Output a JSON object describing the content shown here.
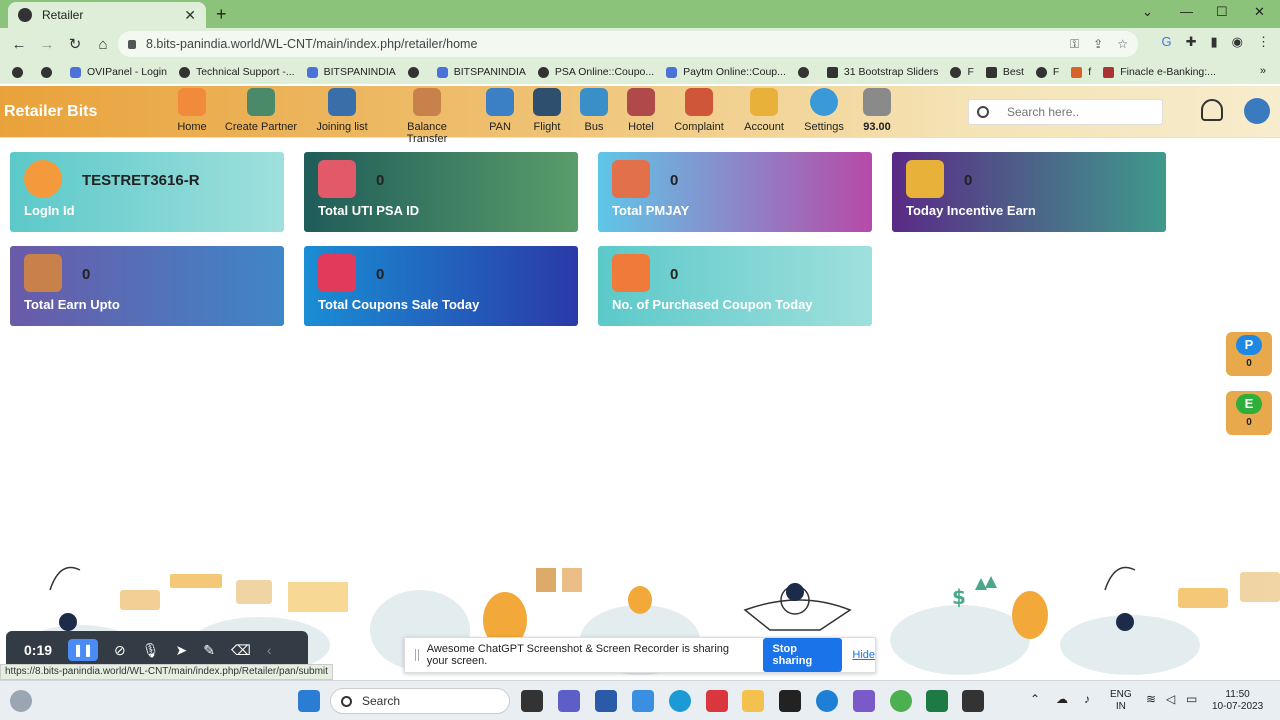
{
  "browser": {
    "tab_title": "Retailer",
    "url": "8.bits-panindia.world/WL-CNT/main/index.php/retailer/home",
    "bookmarks": [
      "OVIPanel - Login",
      "Technical Support -...",
      "BITSPANINDIA",
      "BITSPANINDIA",
      "PSA Online::Coupo...",
      "Paytm Online::Coup...",
      "31 Bootstrap Sliders",
      "F",
      "Best",
      "F",
      "f",
      "Finacle e-Banking:..."
    ],
    "status_url": "https://8.bits-panindia.world/WL-CNT/main/index.php/Retailer/pan/submit"
  },
  "appbar": {
    "brand": "Retailer Bits",
    "menu": [
      {
        "label": "Home",
        "icon": "home-icon",
        "color": "#f28a3c"
      },
      {
        "label": "Create Partner",
        "icon": "partner-icon",
        "color": "#4a8a6a"
      },
      {
        "label": "Joining list",
        "icon": "link-icon",
        "color": "#3a6ea8"
      },
      {
        "label": "Balance Transfer",
        "icon": "money-bag-icon",
        "color": "#c8814a"
      },
      {
        "label": "PAN",
        "icon": "pan-card-icon",
        "color": "#3b7fc4"
      },
      {
        "label": "Flight",
        "icon": "flight-icon",
        "color": "#2f4f6f"
      },
      {
        "label": "Bus",
        "icon": "bus-icon",
        "color": "#3a8fc8"
      },
      {
        "label": "Hotel",
        "icon": "hotel-icon",
        "color": "#b04a4a"
      },
      {
        "label": "Complaint",
        "icon": "complaint-icon",
        "color": "#d0563a"
      },
      {
        "label": "Account",
        "icon": "coins-icon",
        "color": "#e8b23a"
      },
      {
        "label": "Settings",
        "icon": "gear-icon",
        "color": "#3a9ad9"
      },
      {
        "label": "93.00",
        "icon": "wallet-icon",
        "color": "#8a8a8a"
      }
    ],
    "search_placeholder": "Search here.."
  },
  "cards": [
    {
      "value": "TESTRET3616-R",
      "label": "LogIn Id",
      "icon": "user-avatar-icon"
    },
    {
      "value": "0",
      "label": "Total UTI PSA ID",
      "icon": "shop-icon"
    },
    {
      "value": "0",
      "label": "Total PMJAY",
      "icon": "health-team-icon"
    },
    {
      "value": "0",
      "label": "Today Incentive Earn",
      "icon": "incentive-icon"
    },
    {
      "value": "0",
      "label": "Total Earn Upto",
      "icon": "rupee-bag-icon"
    },
    {
      "value": "0",
      "label": "Total Coupons Sale Today",
      "icon": "sale-tag-icon"
    },
    {
      "value": "0",
      "label": "No. of Purchased Coupon Today",
      "icon": "coupon-icon"
    }
  ],
  "side_pills": [
    {
      "letter": "P",
      "value": "0",
      "color": "#1e88e5"
    },
    {
      "letter": "E",
      "value": "0",
      "color": "#2eae3a"
    }
  ],
  "recorder": {
    "time": "0:19"
  },
  "share_bar": {
    "message": "Awesome ChatGPT Screenshot & Screen Recorder is sharing your screen.",
    "stop_label": "Stop sharing",
    "hide_label": "Hide"
  },
  "taskbar": {
    "search_label": "Search",
    "lang_top": "ENG",
    "lang_bottom": "IN",
    "time": "11:50",
    "date": "10-07-2023"
  }
}
